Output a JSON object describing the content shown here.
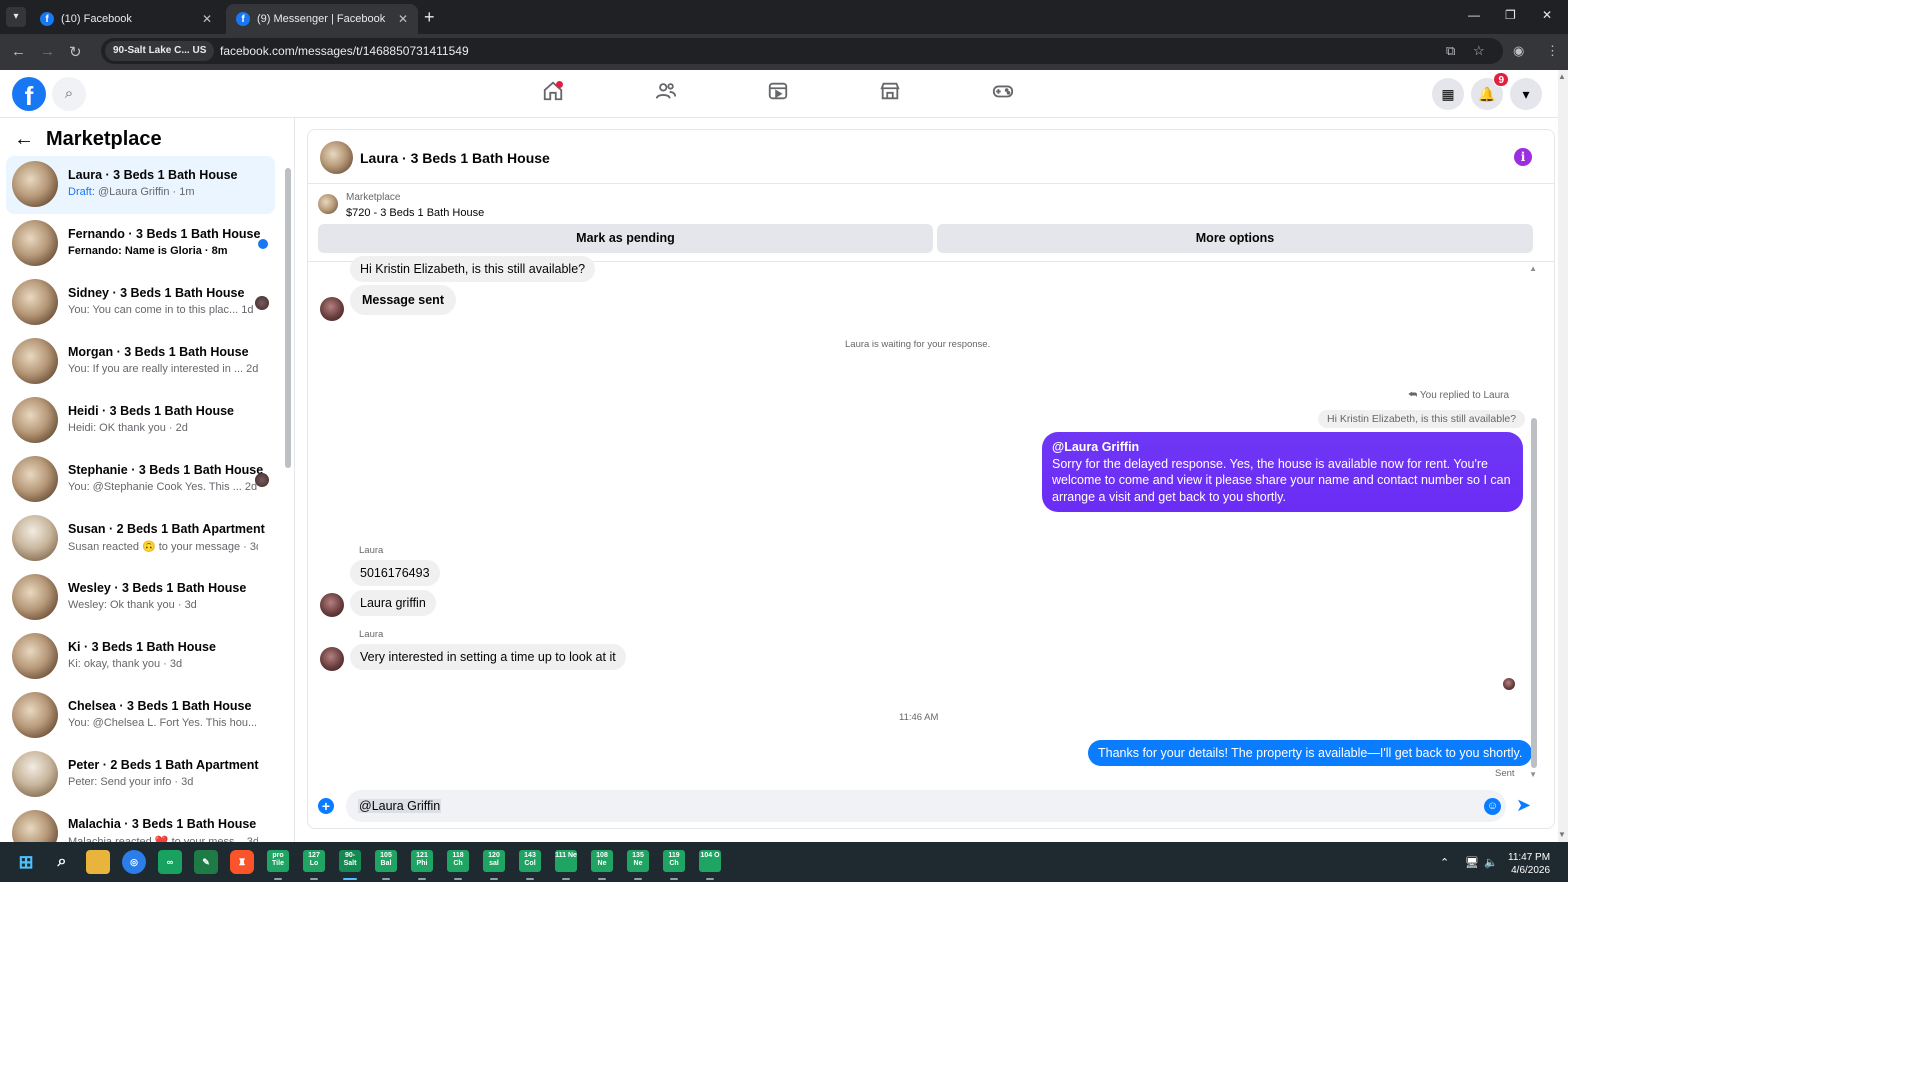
{
  "browser": {
    "tabs": [
      {
        "label": "(10) Facebook",
        "active": false
      },
      {
        "label": "(9) Messenger | Facebook",
        "active": true
      }
    ],
    "site_chip": "90-Salt Lake C... US",
    "url": "facebook.com/messages/t/1468850731411549"
  },
  "header": {
    "notification_count": "9",
    "nav_icons": [
      "home-icon",
      "friends-icon",
      "video-icon",
      "marketplace-icon",
      "gaming-icon"
    ]
  },
  "sidebar": {
    "title": "Marketplace",
    "conversations": [
      {
        "title": "Laura · 3 Beds 1 Bath House",
        "draft": "Draft:",
        "preview": "@Laura Griffin · 1m",
        "active": true,
        "type": "house"
      },
      {
        "title": "Fernando · 3 Beds 1 Bath House",
        "preview": "Fernando: Name is Gloria · 8m",
        "unread": true,
        "type": "house"
      },
      {
        "title": "Sidney · 3 Beds 1 Bath House",
        "preview": "You: You can come in to this plac... 1d",
        "seen_avatar": true,
        "type": "house"
      },
      {
        "title": "Morgan · 3 Beds 1 Bath House",
        "preview": "You: If you are really interested in ... 2d",
        "type": "house"
      },
      {
        "title": "Heidi · 3 Beds 1 Bath House",
        "preview": "Heidi: OK thank you · 2d",
        "type": "house"
      },
      {
        "title": "Stephanie · 3 Beds 1 Bath House",
        "preview": "You: @Stephanie Cook Yes. This ... 2d",
        "seen_avatar": true,
        "type": "house"
      },
      {
        "title": "Susan · 2 Beds 1 Bath Apartment",
        "preview": "Susan reacted 🙃 to your message · 3d",
        "type": "apt"
      },
      {
        "title": "Wesley · 3 Beds 1 Bath House",
        "preview": "Wesley: Ok thank you · 3d",
        "type": "house"
      },
      {
        "title": "Ki · 3 Beds 1 Bath House",
        "preview": "Ki: okay, thank you · 3d",
        "type": "house"
      },
      {
        "title": "Chelsea · 3 Beds 1 Bath House",
        "preview": "You: @Chelsea L. Fort Yes. This hou... 3d",
        "type": "house"
      },
      {
        "title": "Peter · 2 Beds 1 Bath Apartment",
        "preview": "Peter: Send your info · 3d",
        "type": "apt"
      },
      {
        "title": "Malachia · 3 Beds 1 Bath House",
        "preview": "Malachia reacted ❤️ to your mess... 3d",
        "type": "house"
      }
    ]
  },
  "chat": {
    "title": "Laura · 3 Beds 1 Bath House",
    "listing_category": "Marketplace",
    "listing_name": "$720 - 3 Beds 1 Bath House",
    "mark_pending_label": "Mark as pending",
    "more_options_label": "More options",
    "msg_first": "Hi Kristin Elizabeth, is this still available?",
    "msg_sent": "Message sent",
    "waiting_note": "Laura is waiting for your response.",
    "replied_note": "You replied to Laura",
    "quoted": "Hi Kristin Elizabeth, is this still available?",
    "reply_mention": "@Laura Griffin",
    "reply_body": "Sorry for the delayed response. Yes, the house is available now for rent. You're welcome to come and view it please share your name and contact number so I can arrange a visit and get back to you shortly.",
    "sender_name": "Laura",
    "msg_phone": "5016176493",
    "msg_name": "Laura griffin",
    "sender_name_2": "Laura",
    "msg_interest": "Very interested in setting a time up to look at it",
    "timestamp": "11:46 AM",
    "msg_last": "Thanks for your details! The property is available—I'll get back to you shortly.",
    "status": "Sent",
    "composer_text": "@Laura Griffin"
  },
  "taskbar": {
    "tiles": [
      "pro Tile",
      "127 Lo",
      "90- Salt",
      "105 Bal",
      "121 Phi",
      "118 Ch",
      "120 sal",
      "143 Col",
      "111 Ne",
      "108 Ne",
      "135 Ne",
      "119 Ch",
      "104 O"
    ],
    "time": "11:47 PM",
    "date": "4/6/2026"
  },
  "colors": {
    "fb_blue": "#1877f2",
    "outgoing_purple": "#6b2cf5",
    "outgoing_blue": "#0a7cff"
  }
}
